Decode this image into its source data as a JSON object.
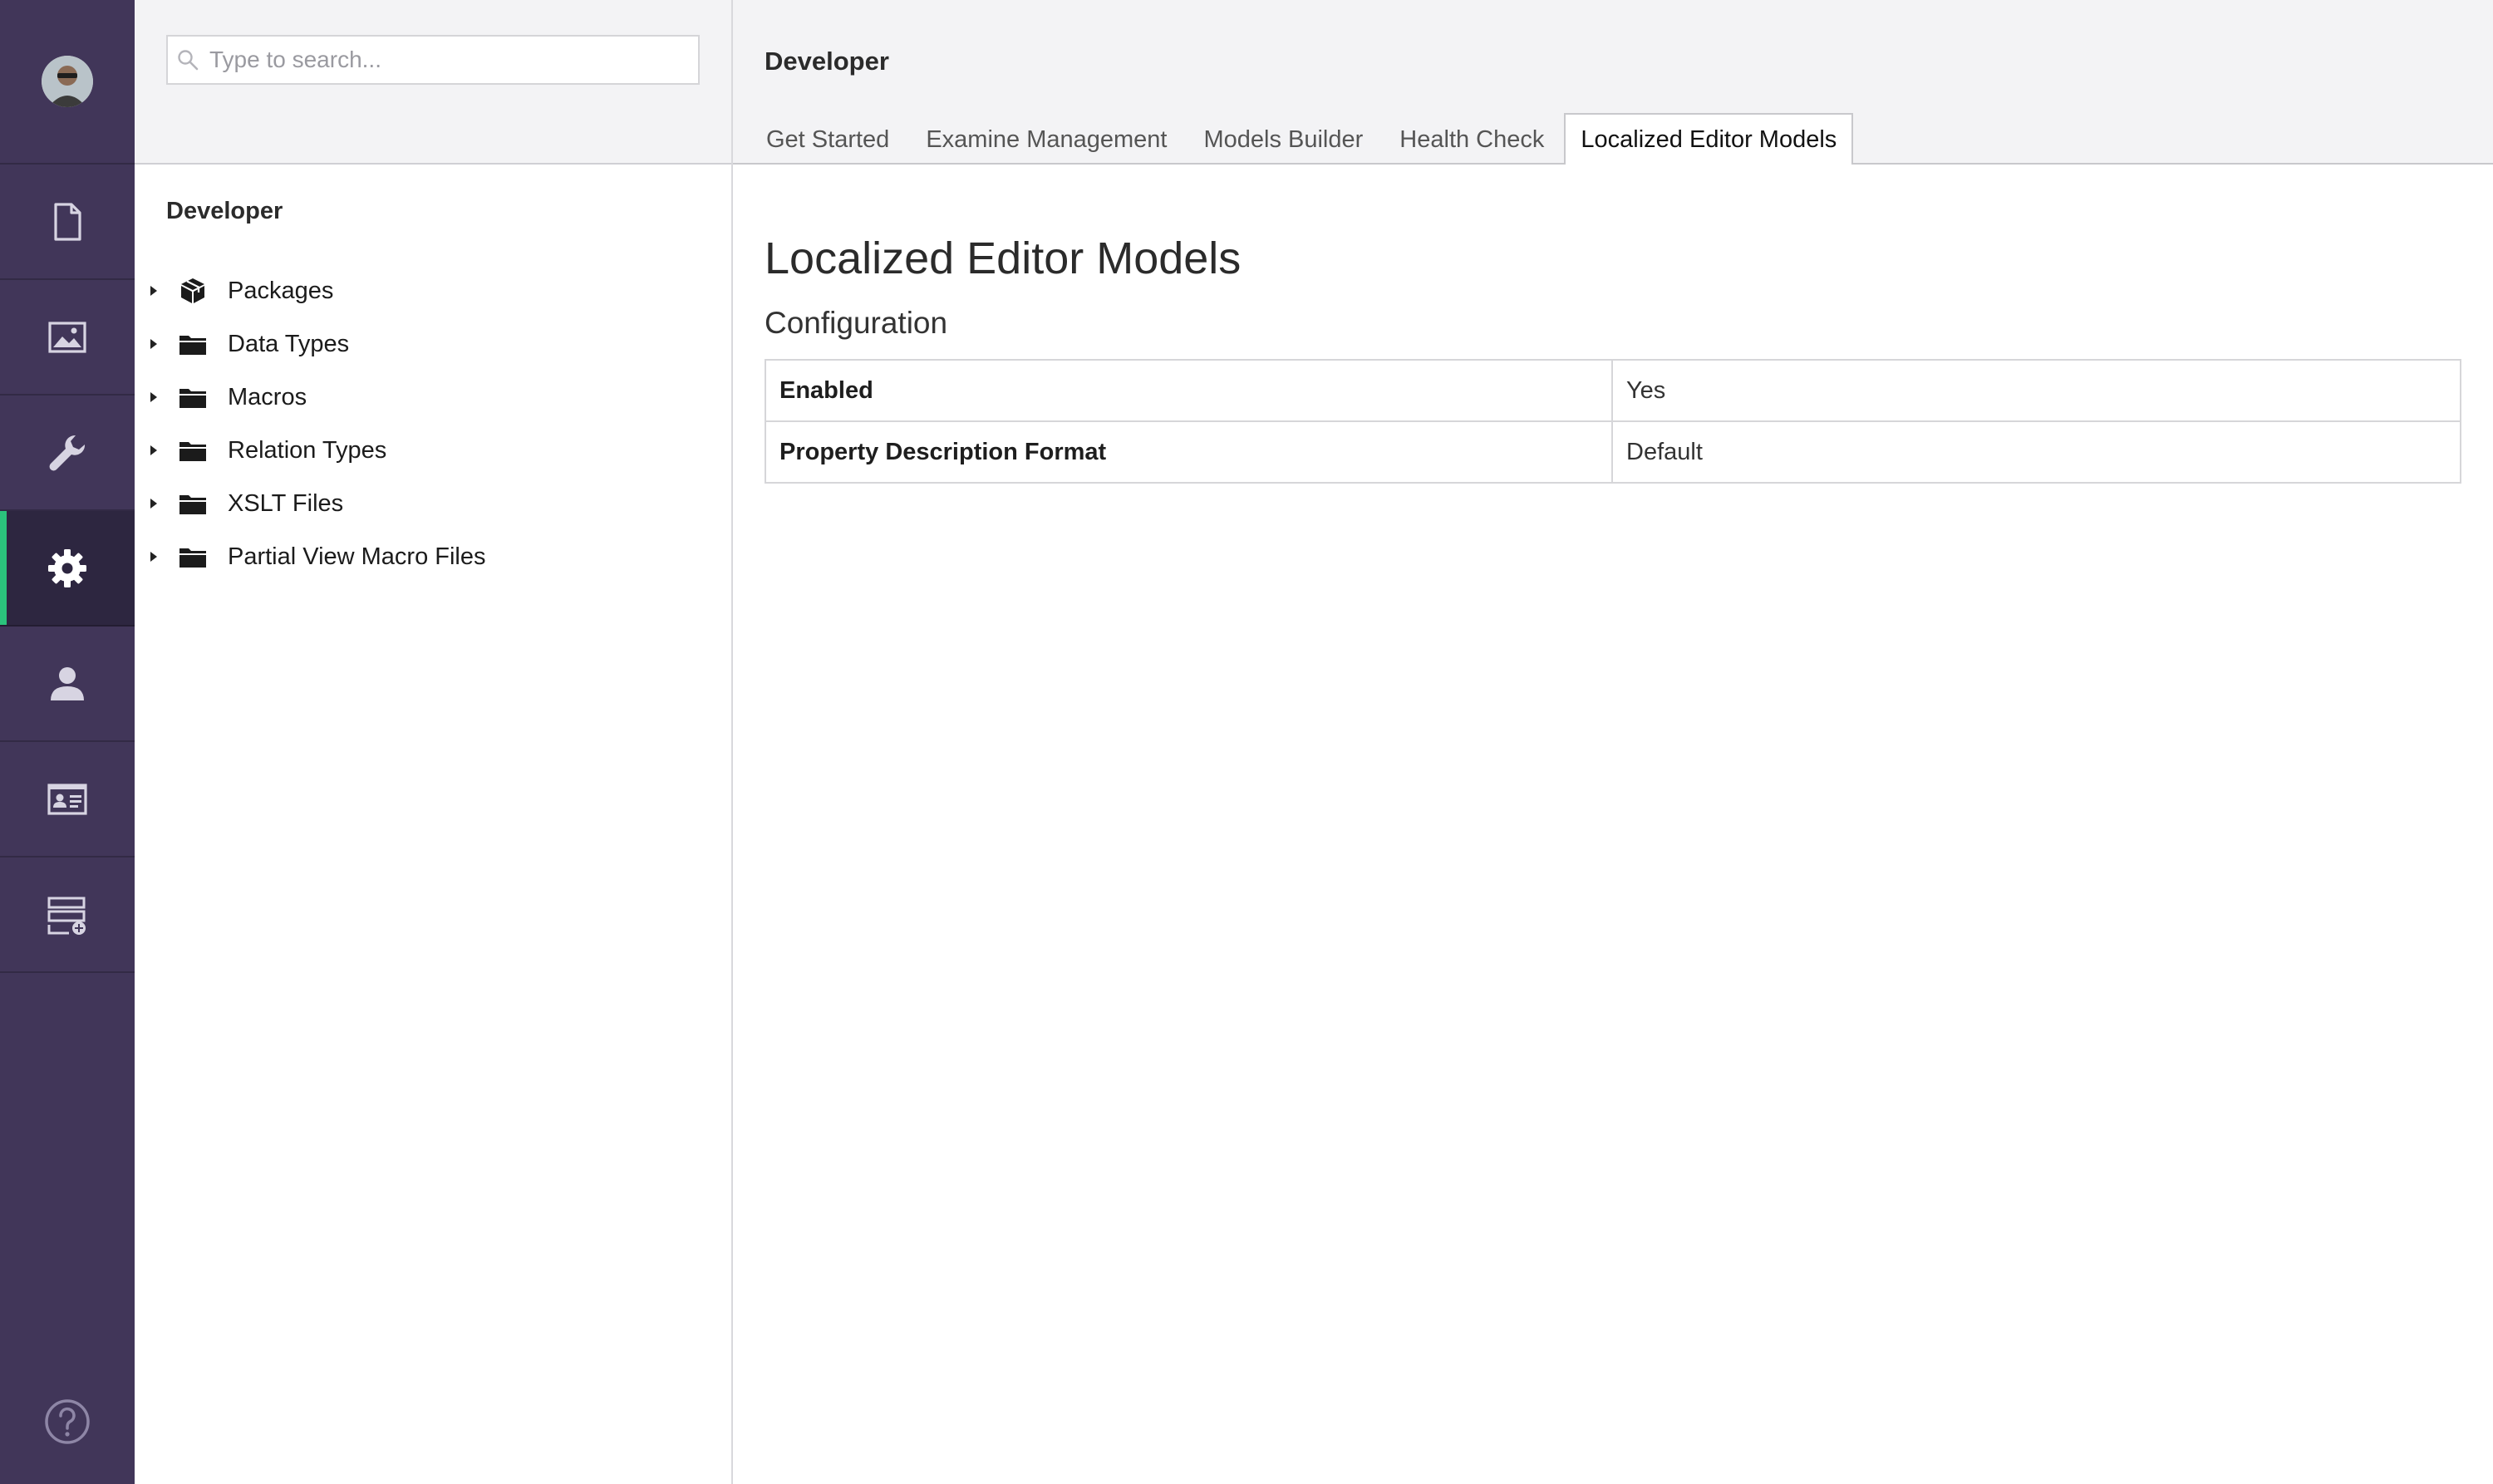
{
  "colors": {
    "rail_background": "#413659",
    "rail_active_background": "#2d2640",
    "rail_active_accent": "#2bc37c",
    "rail_icon": "#d7d4e2",
    "header_background": "#f3f3f5"
  },
  "rail": {
    "avatar_icon": "user-avatar",
    "sections": [
      {
        "id": "content",
        "icon": "document-icon",
        "active": false
      },
      {
        "id": "media",
        "icon": "image-icon",
        "active": false
      },
      {
        "id": "settings",
        "icon": "wrench-icon",
        "active": false
      },
      {
        "id": "developer",
        "icon": "gear-icon",
        "active": true
      },
      {
        "id": "users",
        "icon": "user-icon",
        "active": false
      },
      {
        "id": "members",
        "icon": "id-card-icon",
        "active": false
      },
      {
        "id": "forms",
        "icon": "form-add-icon",
        "active": false
      }
    ],
    "help_icon": "help-icon"
  },
  "tree": {
    "search": {
      "placeholder": "Type to search..."
    },
    "title": "Developer",
    "items": [
      {
        "label": "Packages",
        "icon": "package-icon"
      },
      {
        "label": "Data Types",
        "icon": "folder-icon"
      },
      {
        "label": "Macros",
        "icon": "folder-icon"
      },
      {
        "label": "Relation Types",
        "icon": "folder-icon"
      },
      {
        "label": "XSLT Files",
        "icon": "folder-icon"
      },
      {
        "label": "Partial View Macro Files",
        "icon": "folder-icon"
      }
    ]
  },
  "main": {
    "title": "Developer",
    "tabs": [
      {
        "label": "Get Started",
        "active": false
      },
      {
        "label": "Examine Management",
        "active": false
      },
      {
        "label": "Models Builder",
        "active": false
      },
      {
        "label": "Health Check",
        "active": false
      },
      {
        "label": "Localized Editor Models",
        "active": true
      }
    ],
    "heading": "Localized Editor Models",
    "section": "Configuration",
    "config": [
      {
        "key": "Enabled",
        "value": "Yes"
      },
      {
        "key": "Property Description Format",
        "value": "Default"
      }
    ]
  }
}
